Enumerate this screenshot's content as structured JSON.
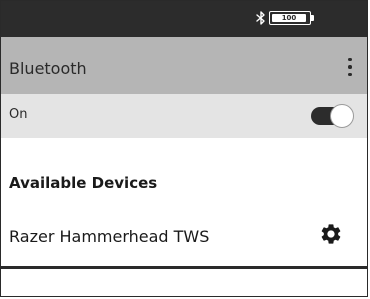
{
  "status_bar": {
    "bluetooth_icon": "bluetooth-icon",
    "battery_icon": "battery-icon",
    "battery_text": "100"
  },
  "app_bar": {
    "title": "Bluetooth",
    "menu_icon": "more-vert-icon"
  },
  "toggle": {
    "label": "On",
    "state": true
  },
  "available_devices": {
    "header": "Available Devices",
    "devices": [
      {
        "name": "Razer Hammerhead TWS",
        "settings_icon": "gear-icon"
      }
    ]
  },
  "colors": {
    "status_bar_bg": "#2c2c2c",
    "app_bar_bg": "#b5b5b5",
    "toggle_row_bg": "#e4e4e4",
    "toggle_track_on": "#2c2c2c"
  }
}
